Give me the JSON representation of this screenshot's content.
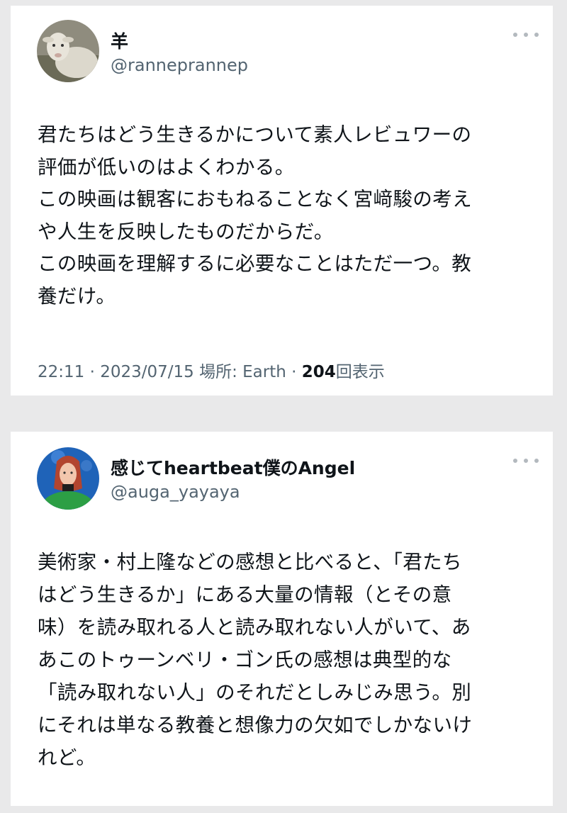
{
  "tweets": [
    {
      "name": "羊",
      "handle": "@ranneprannep",
      "lines": [
        "君たちはどう生きるかについて素人レビュワーの",
        "評価が低いのはよくわかる。",
        "この映画は観客におもねることなく宮﨑駿の考え",
        "や人生を反映したものだからだ。",
        "この映画を理解するに必要なことはただ一つ。教",
        "養だけ。"
      ],
      "meta_prefix": "22:11 · 2023/07/15 場所: Earth · ",
      "views_count": "204",
      "views_label": "回表示"
    },
    {
      "name": "感じてheartbeat僕のAngel",
      "handle": "@auga_yayaya",
      "lines": [
        "美術家・村上隆などの感想と比べると、「君たち",
        "はどう生きるか」にある大量の情報（とその意",
        "味）を読み取れる人と読み取れない人がいて、あ",
        "あこのトゥーンベリ・ゴン氏の感想は典型的な",
        "「読み取れない人」のそれだとしみじみ思う。別",
        "にそれは単なる教養と想像力の欠如でしかないけ",
        "れど。"
      ]
    }
  ]
}
